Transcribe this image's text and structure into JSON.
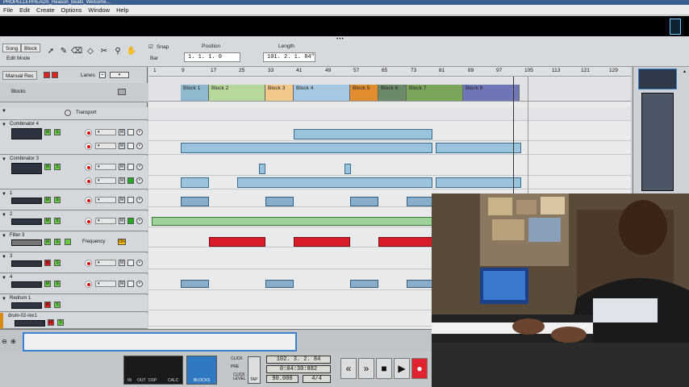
{
  "window": {
    "title": "PROPELLERHEADS_Reason_Beats_Welcome..."
  },
  "menu": [
    "File",
    "Edit",
    "Create",
    "Options",
    "Window",
    "Help"
  ],
  "toolbar": {
    "song": "Song",
    "block": "Block",
    "edit_mode": "Edit Mode",
    "snap": "Snap",
    "snap_value": "Bar",
    "position_label": "Position",
    "position_value": "1.  1.  1.    0",
    "length_label": "Length",
    "length_value": "101.  2.  1.  84\"",
    "manual_rec": "Manual Rec",
    "lanes": "Lanes"
  },
  "ruler": [
    "1",
    "9",
    "17",
    "25",
    "33",
    "41",
    "49",
    "57",
    "65",
    "73",
    "81",
    "89",
    "97",
    "105",
    "113",
    "121",
    "129"
  ],
  "blocks_label": "Blocks",
  "blocks": [
    {
      "name": "Block 1",
      "color": "#8fb9cf"
    },
    {
      "name": "Block 2",
      "color": "#b8d79a"
    },
    {
      "name": "Block 3",
      "color": "#f2c98a"
    },
    {
      "name": "Block 4",
      "color": "#a6c8e2"
    },
    {
      "name": "Block 5",
      "color": "#e08c2f"
    },
    {
      "name": "Block 6",
      "color": "#6a8a6a"
    },
    {
      "name": "Block 7",
      "color": "#7aa55a"
    },
    {
      "name": "Block 8",
      "color": "#6f76b8"
    }
  ],
  "tracks": [
    {
      "name": "Transport"
    },
    {
      "name": "Combinator 4"
    },
    {
      "name": "Combinator 3"
    },
    {
      "name": "1"
    },
    {
      "name": "2"
    },
    {
      "name": "Filter 3",
      "param": "Frequency"
    },
    {
      "name": "3"
    },
    {
      "name": "4"
    },
    {
      "name": "Redrum 1"
    },
    {
      "name": "drum-02-rex1"
    }
  ],
  "transport": {
    "position": "102.  3.  2.  84",
    "time": "0:04:30:882",
    "tempo": "90.000",
    "signature": "4/4",
    "blocks_label": "BLOCKS",
    "click": "CLICK",
    "pre": "PRE",
    "click_level": "CLICK LEVEL",
    "tap": "TAP",
    "in": "IN",
    "out": "OUT",
    "dsp": "DSP",
    "calc": "CALC"
  }
}
